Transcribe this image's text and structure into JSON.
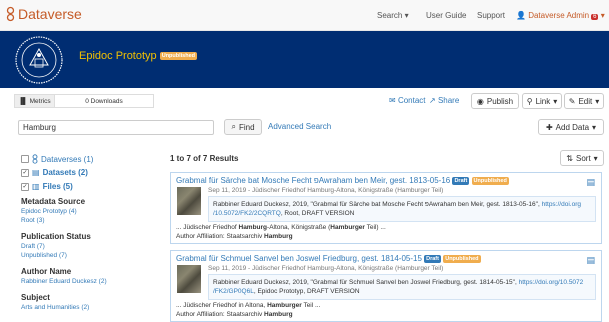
{
  "navbar": {
    "brand": "Dataverse",
    "search": "Search",
    "user_guide": "User Guide",
    "support": "Support",
    "user": "Dataverse Admin",
    "notif_count": "6"
  },
  "dataverse": {
    "name": "Epidoc Prototyp",
    "status": "Unpublished"
  },
  "metrics": {
    "tab": "Metrics",
    "downloads": "0 Downloads"
  },
  "actions": {
    "contact": "Contact",
    "share": "Share",
    "publish": "Publish",
    "link": "Link",
    "edit": "Edit",
    "add_data": "Add Data",
    "sort": "Sort"
  },
  "search": {
    "value": "Hamburg",
    "find": "Find",
    "advanced": "Advanced Search"
  },
  "facets": {
    "types": [
      {
        "label": "Dataverses (1)",
        "checked": false
      },
      {
        "label": "Datasets (2)",
        "checked": true
      },
      {
        "label": "Files (5)",
        "checked": true
      }
    ],
    "metadata_source": {
      "title": "Metadata Source",
      "values": [
        "Epidoc Prototyp (4)",
        "Root (3)"
      ]
    },
    "publication_status": {
      "title": "Publication Status",
      "values": [
        "Draft (7)",
        "Unpublished (7)"
      ]
    },
    "author_name": {
      "title": "Author Name",
      "values": [
        "Rabbiner Eduard Duckesz (2)"
      ]
    },
    "subject": {
      "title": "Subject",
      "values": [
        "Arts and Humanities (2)"
      ]
    }
  },
  "results": {
    "count": "1 to 7 of 7 Results",
    "items": [
      {
        "title": "Grabmal für Särche bat Mosche Fecht פAwraham ben Meir, gest. 1813-05-16",
        "badges": [
          "Draft",
          "Unpublished"
        ],
        "meta": "Sep 11, 2019 - Jüdischer Friedhof Hamburg-Altona, Königstraße (Hamburger Teil)",
        "citation": "Rabbiner Eduard Duckesz, 2019, \"Grabmal für Särche bat Mosche Fecht פAwraham ben Meir, gest. 1813-05-16\",",
        "doi_a": "https://doi.org",
        "doi_b": "/10.5072/FK2/2CQRTQ",
        "citation_tail": ", Root, DRAFT VERSION",
        "snippet_1a": "... Jüdischer Friedhof ",
        "snippet_1b": "Hamburg",
        "snippet_1c": "-Altona, Königstraße (",
        "snippet_1d": "Hamburger",
        "snippet_1e": " Teil) ...",
        "snippet_2a": "Author Affiliation: Staatsarchiv ",
        "snippet_2b": "Hamburg"
      },
      {
        "title": "Grabmal für Schmuel Sanvel ben Joswel Friedburg, gest. 1814-05-15",
        "badges": [
          "Draft",
          "Unpublished"
        ],
        "meta": "Sep 11, 2019 - Jüdischer Friedhof Hamburg-Altona, Königstraße (Hamburger Teil)",
        "citation": "Rabbiner Eduard Duckesz, 2019, \"Grabmal für Schmuel Sanvel ben Joswel Friedburg, gest. 1814-05-15\",",
        "doi_a": "https://doi.org/10.5072",
        "doi_b": "/FK2/GP0Q6L",
        "citation_tail": ", Epidoc Prototyp, DRAFT VERSION",
        "snippet_1a": "... Jüdischer Friedhof in Altona, ",
        "snippet_1b": "Hamburger",
        "snippet_1c": " Teil ...",
        "snippet_2a": "Author Affiliation: Staatsarchiv ",
        "snippet_2b": "Hamburg"
      }
    ]
  },
  "colors": {
    "brand": "#c55b28",
    "header_bg": "#002d72",
    "dataverse_name": "#f2c000",
    "link": "#337ab7",
    "draft": "#337ab7",
    "unpublished": "#f0ad4e"
  }
}
